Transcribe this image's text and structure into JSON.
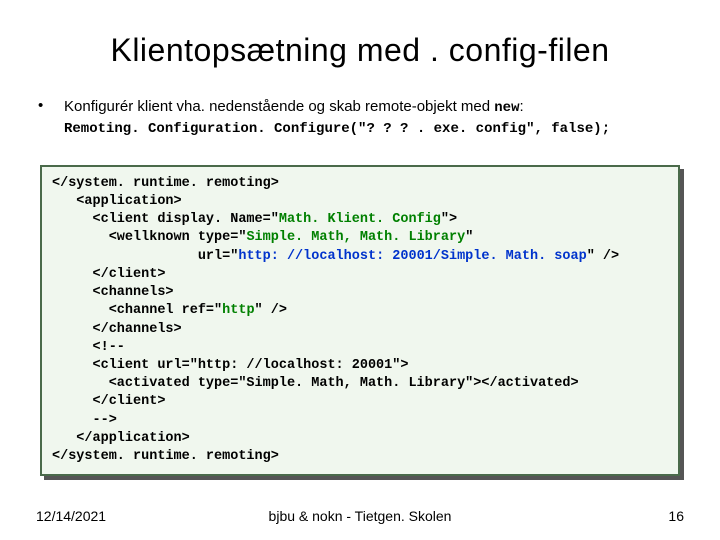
{
  "title": "Klientopsætning med . config-filen",
  "bullet": {
    "lead": "Konfigurér klient vha. nedenstående og skab remote-objekt med ",
    "new_kw": "new",
    "trail": ":",
    "code": "Remoting. Configuration. Configure(\"? ? ? . exe. config\", false);"
  },
  "xml": {
    "l1": "</system. runtime. remoting>",
    "l2": "   <application>",
    "l3a": "     <client display. Name=\"",
    "l3b": "Math. Klient. Config",
    "l3c": "\">",
    "l4a": "       <wellknown type=\"",
    "l4b": "Simple. Math, Math. Library",
    "l4c": "\"",
    "l5a": "                  url=\"",
    "l5b": "http: //localhost: 20001/Simple. Math. soap",
    "l5c": "\" />",
    "l6": "     </client>",
    "l7": "     <channels>",
    "l8a": "       <channel ref=\"",
    "l8b": "http",
    "l8c": "\" />",
    "l9": "     </channels>",
    "l10": "     <!--",
    "l11": "     <client url=\"http: //localhost: 20001\">",
    "l12": "       <activated type=\"Simple. Math, Math. Library\"></activated>",
    "l13": "     </client>",
    "l14": "     -->",
    "l15": "   </application>",
    "l16": "</system. runtime. remoting>"
  },
  "footer": {
    "date": "12/14/2021",
    "center": "bjbu & nokn - Tietgen. Skolen",
    "page": "16"
  }
}
